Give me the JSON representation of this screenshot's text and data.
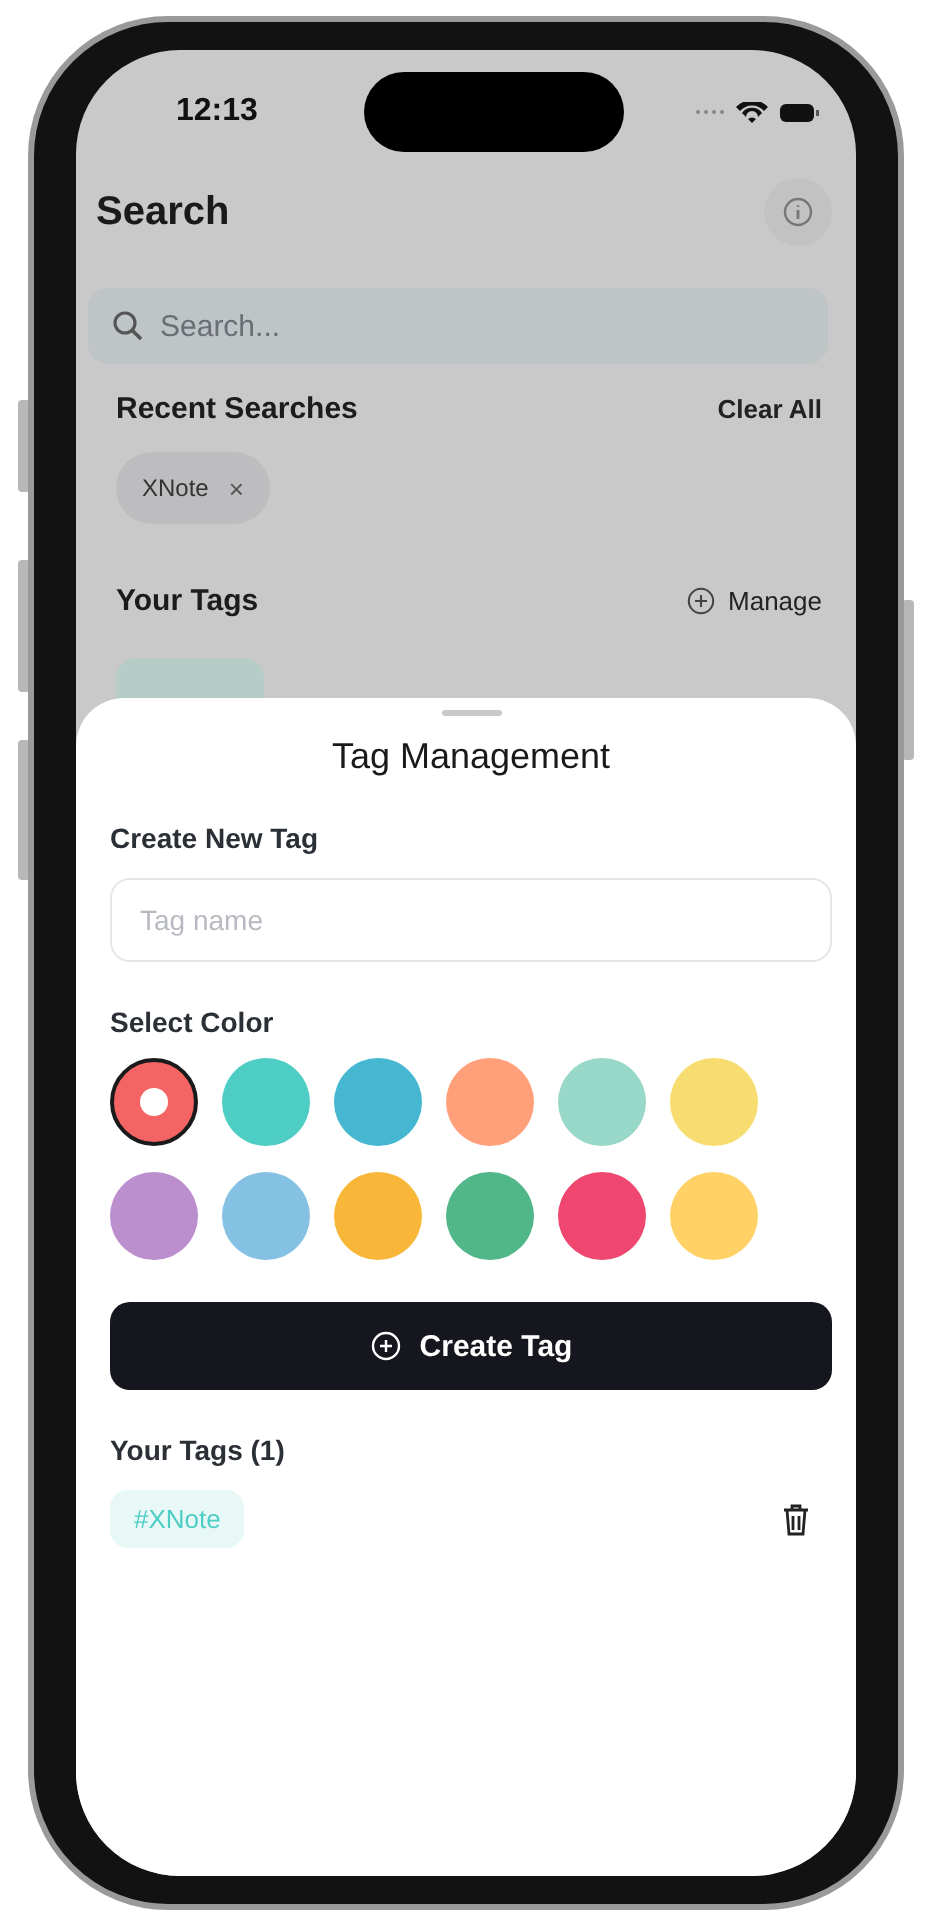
{
  "status_bar": {
    "time": "12:13"
  },
  "header": {
    "title": "Search"
  },
  "search": {
    "placeholder": "Search..."
  },
  "recent_searches": {
    "title": "Recent Searches",
    "action": "Clear All",
    "items": [
      {
        "label": "XNote",
        "remove": "×"
      }
    ]
  },
  "your_tags": {
    "title": "Your Tags",
    "action": "Manage"
  },
  "sheet": {
    "title": "Tag Management",
    "create_label": "Create New Tag",
    "input": {
      "placeholder": "Tag name"
    },
    "color_label": "Select Color",
    "colors": [
      {
        "color": "#f46464",
        "selected": true
      },
      {
        "color": "#4ecdc4",
        "selected": false
      },
      {
        "color": "#45b7d1",
        "selected": false
      },
      {
        "color": "#ffa07a",
        "selected": false
      },
      {
        "color": "#98d8c8",
        "selected": false
      },
      {
        "color": "#f7dc6f",
        "selected": false
      },
      {
        "color": "#bb8fce",
        "selected": false
      },
      {
        "color": "#85c1e2",
        "selected": false
      },
      {
        "color": "#f8b739",
        "selected": false
      },
      {
        "color": "#52b788",
        "selected": false
      },
      {
        "color": "#ef476f",
        "selected": false
      },
      {
        "color": "#ffd166",
        "selected": false
      }
    ],
    "button": "Create Tag",
    "tags_title": "Your Tags (1)",
    "tags": [
      {
        "label": "#XNote",
        "color": "#4ecdc4"
      }
    ]
  }
}
